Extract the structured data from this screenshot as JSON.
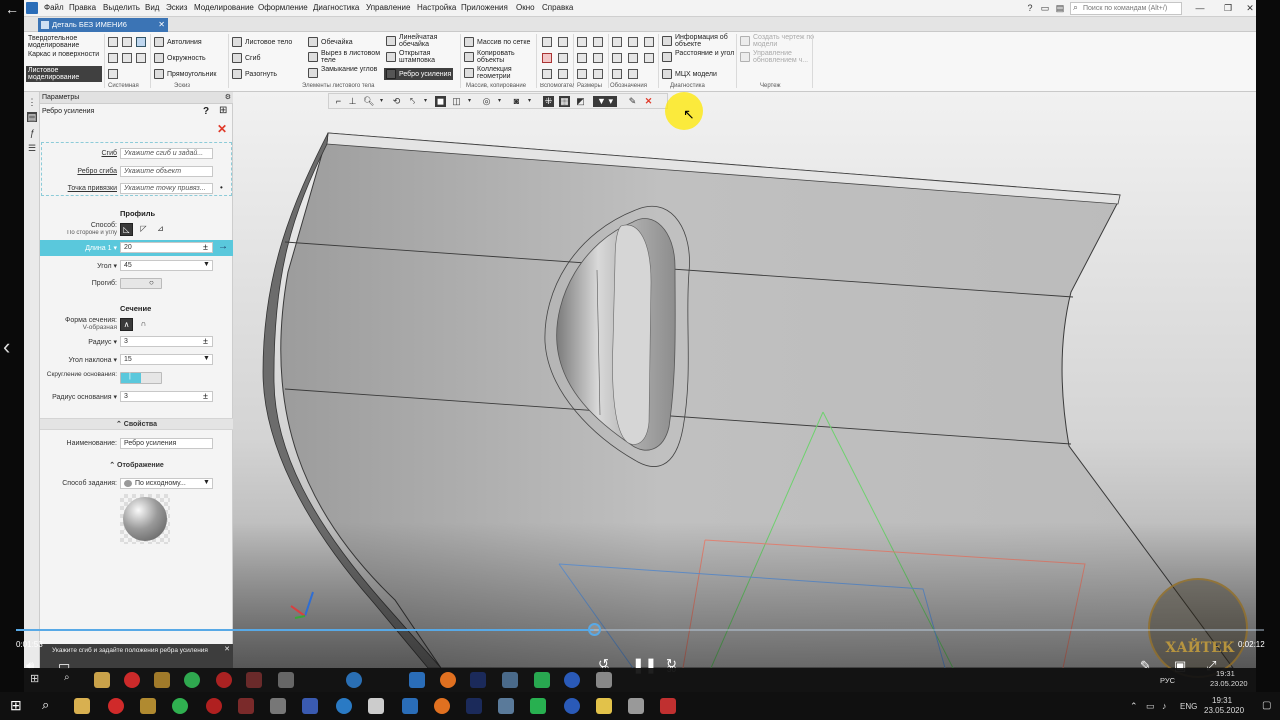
{
  "menu": {
    "items": [
      "Файл",
      "Правка",
      "Выделить",
      "Вид",
      "Эскиз",
      "Моделирование",
      "Оформление",
      "Диагностика",
      "Управление",
      "Настройка",
      "Приложения",
      "Окно",
      "Справка"
    ],
    "search_placeholder": "Поиск по командам (Alt+/)"
  },
  "document_tab": {
    "label": "Деталь БЕЗ ИМЕНИ6"
  },
  "ribbon": {
    "modes": [
      {
        "label": "Твердотельное моделирование"
      },
      {
        "label": "Каркас и поверхности"
      },
      {
        "label": "Листовое моделирование",
        "selected": true
      }
    ],
    "sketch_tools": [
      "Автолиния",
      "Окружность",
      "Прямоугольник"
    ],
    "sheet_tools": [
      "Листовое тело",
      "Сгиб",
      "Разогнуть",
      "Обечайка",
      "Вырез в листовом теле",
      "Замыкание углов",
      "Линейчатая обечайка",
      "Открытая штамповка",
      "Ребро усиления"
    ],
    "array_tools": [
      "Массив по сетке",
      "Копировать объекты",
      "Коллекция геометрии"
    ],
    "diag_tools": [
      "Информация об объекте",
      "Расстояние и угол",
      "МЦХ модели"
    ],
    "drawing_tools": [
      "Создать чертеж по модели",
      "Управление обновлением ч..."
    ],
    "group_captions": [
      "Системная",
      "Эскиз",
      "Элементы листового тела",
      "Массив, копирование",
      "Вспомогательн...",
      "Размеры",
      "Обозначения",
      "Диагностика",
      "Чертеж"
    ]
  },
  "panel": {
    "title": "Параметры",
    "operation": "Ребро усиления",
    "selectors": [
      {
        "label": "Сгиб",
        "value": "Укажите сгиб и задай..."
      },
      {
        "label": "Ребро сгиба",
        "value": "Укажите объект"
      },
      {
        "label": "Точка привязки",
        "value": "Укажите точку привяз..."
      }
    ],
    "profile": {
      "heading": "Профиль",
      "method_label": "Способ:",
      "method_value": "По стороне и углу",
      "length_label": "Длина 1",
      "length_value": "20",
      "angle_label": "Угол",
      "angle_value": "45",
      "deflection_label": "Прогиб:"
    },
    "section": {
      "heading": "Сечение",
      "shape_label": "Форма сечения:",
      "shape_value": "V-образная",
      "radius_label": "Радиус",
      "radius_value": "3",
      "slope_label": "Угол наклона",
      "slope_value": "15",
      "rounding_label": "Скругление основания:",
      "base_radius_label": "Радиус основания",
      "base_radius_value": "3"
    },
    "properties": {
      "heading": "Свойства",
      "name_label": "Наименование:",
      "name_value": "Ребро усиления"
    },
    "display": {
      "heading": "Отображение",
      "method_label": "Способ задания:",
      "method_value": "По исходному..."
    },
    "status_text": "Укажите сгиб и задайте положения ребра усиления"
  },
  "video": {
    "current_time": "0:01:53",
    "total_time": "0:02:12",
    "progress": 0.463,
    "skip_back": "10",
    "skip_forward": "30"
  },
  "watermark": "ХАЙТЕК",
  "taskbar": {
    "lang": "ENG",
    "time": "19:31",
    "date": "23.05.2020",
    "inner_lang": "РУС",
    "inner_time": "19:31",
    "inner_date": "23.05.2020"
  },
  "colors": {
    "accent": "#5ac8dc",
    "tab": "#3b74b5",
    "progress": "#58a9e6",
    "close": "#e03a2a"
  }
}
